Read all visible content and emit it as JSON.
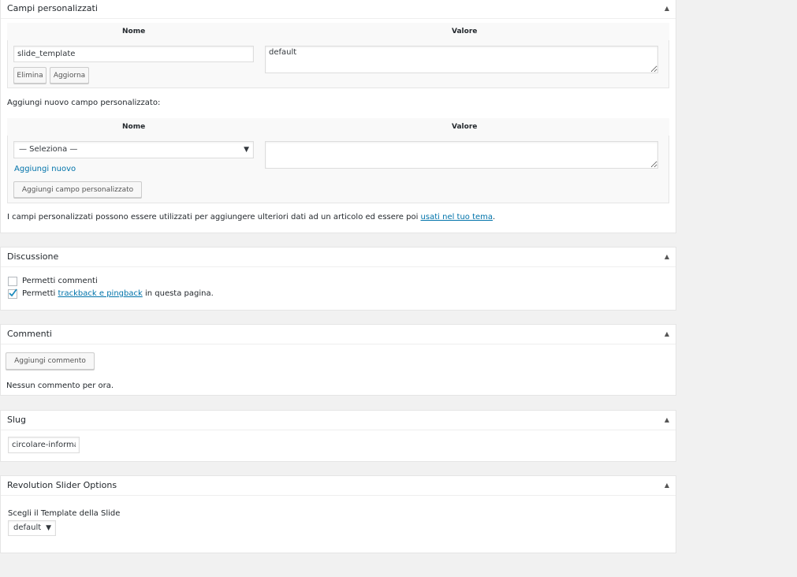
{
  "custom_fields": {
    "title": "Campi personalizzati",
    "col_name": "Nome",
    "col_value": "Valore",
    "row": {
      "name": "slide_template",
      "value": "default"
    },
    "delete_label": "Elimina",
    "update_label": "Aggiorna",
    "add_new_heading": "Aggiungi nuovo campo personalizzato:",
    "select_placeholder": "— Seleziona —",
    "add_new_link": "Aggiungi nuovo",
    "add_button": "Aggiungi campo personalizzato",
    "note_before": "I campi personalizzati possono essere utilizzati per aggiungere ulteriori dati ad un articolo ed essere poi ",
    "note_link": "usati nel tuo tema",
    "note_after": "."
  },
  "discussion": {
    "title": "Discussione",
    "allow_comments": "Permetti commenti",
    "allow_comments_checked": false,
    "allow_pings_before": "Permetti ",
    "allow_pings_link": "trackback e pingback",
    "allow_pings_after": " in questa pagina.",
    "allow_pings_checked": true
  },
  "comments": {
    "title": "Commenti",
    "add_button": "Aggiungi commento",
    "empty_text": "Nessun commento per ora."
  },
  "slug": {
    "title": "Slug",
    "value": "circolare-informa"
  },
  "revslider": {
    "title": "Revolution Slider Options",
    "label": "Scegli il Template della Slide",
    "selected": "default"
  },
  "icons": {
    "toggle": "triangle-up-icon",
    "dropdown": "triangle-down-icon",
    "check": "checkmark-icon"
  },
  "colors": {
    "link": "#0073aa",
    "background": "#f1f1f1",
    "box": "#ffffff"
  }
}
